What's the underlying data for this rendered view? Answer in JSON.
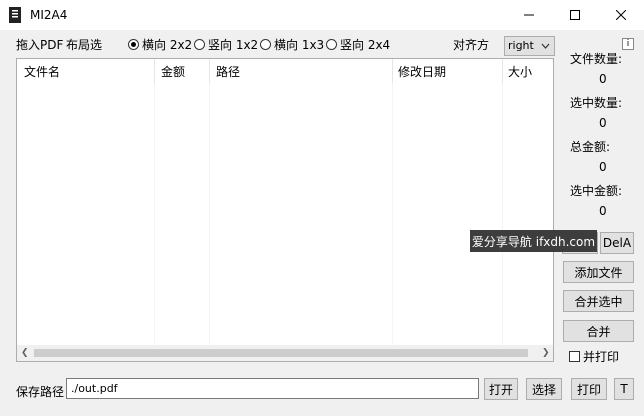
{
  "window": {
    "title": "MI2A4",
    "app_icon": "document-icon",
    "controls": [
      "minimize-icon",
      "maximize-icon",
      "close-icon"
    ]
  },
  "toolbar": {
    "drop_pdf_label": "拖入PDF",
    "layout_label": "布局选",
    "layout_options": [
      {
        "label": "横向 2x2",
        "selected": true
      },
      {
        "label": "竖向 1x2",
        "selected": false
      },
      {
        "label": "横向 1x3",
        "selected": false
      },
      {
        "label": "竖向 2x4",
        "selected": false
      }
    ],
    "align_label": "对齐方",
    "align_value": "right",
    "info_label": "i"
  },
  "table": {
    "columns": [
      "文件名",
      "金额",
      "路径",
      "修改日期",
      "大小"
    ],
    "rows": []
  },
  "stats": {
    "file_count_label": "文件数量:",
    "file_count_value": "0",
    "selected_count_label": "选中数量:",
    "selected_count_value": "0",
    "total_amount_label": "总金额:",
    "total_amount_value": "0",
    "selected_amount_label": "选中金额:",
    "selected_amount_value": "0"
  },
  "side_buttons": {
    "dela": "DelA",
    "add_file": "添加文件",
    "merge_selected": "合并选中",
    "merge": "合并",
    "merge_print_label": "并打印"
  },
  "watermark": "爱分享导航 ifxdh.com",
  "bottom": {
    "save_path_label": "保存路径",
    "save_path_value": "./out.pdf",
    "open": "打开",
    "select": "选择",
    "print": "打印",
    "t": "T"
  },
  "colors": {
    "window_bg": "#f0f0f0",
    "button_bg": "#e1e1e1",
    "border": "#adadad"
  }
}
